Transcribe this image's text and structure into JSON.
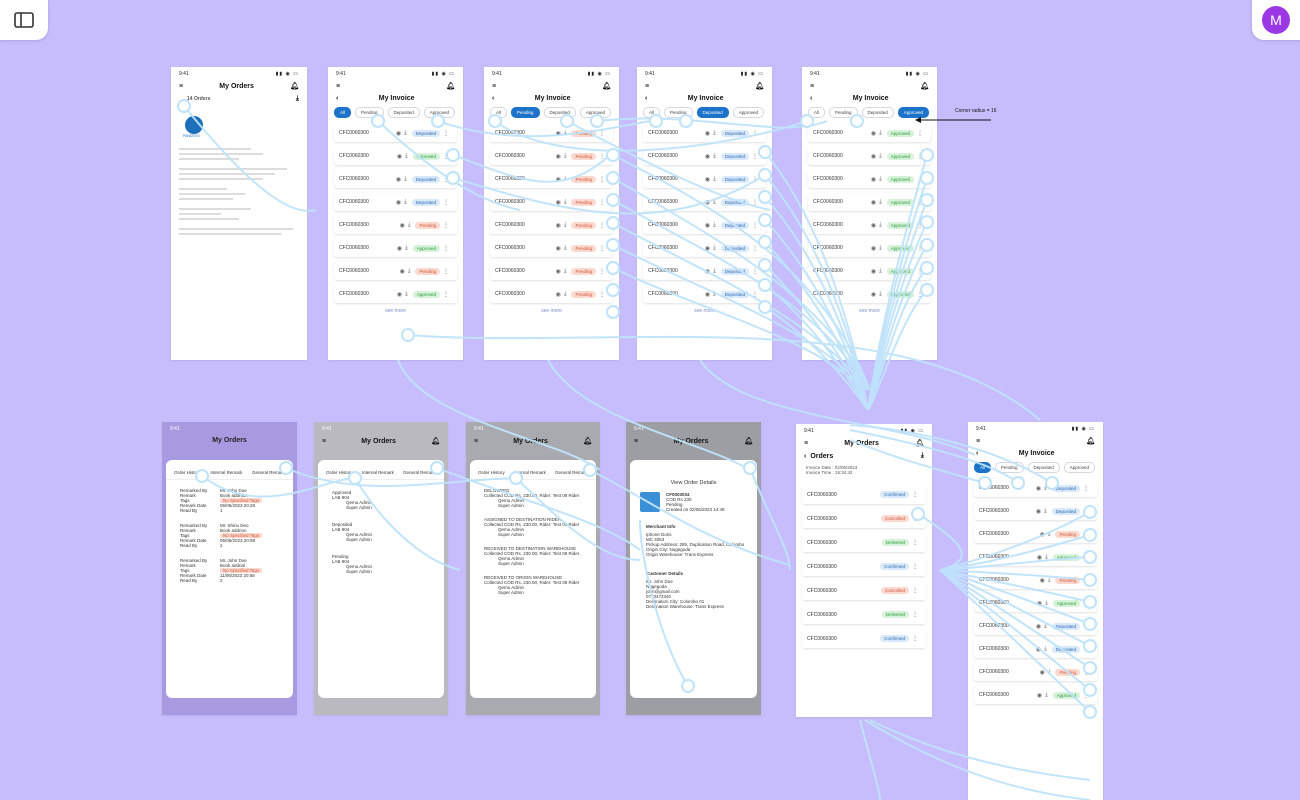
{
  "app": {
    "avatar_letter": "M"
  },
  "status_time": "9:41",
  "annotation": "Corner radius = 16",
  "order_frame": {
    "title": "My Orders",
    "subtitle": "14 Orders",
    "logo": "PANDEXO"
  },
  "invoice_title": "My Invoice",
  "filters": [
    "All",
    "Pending",
    "Deposited",
    "Approved"
  ],
  "frames": [
    {
      "active": "All",
      "rows": [
        [
          "CFC0060300",
          "Deposited"
        ],
        [
          "CFC0060300",
          "Approved"
        ],
        [
          "CFC0060300",
          "Deposited"
        ],
        [
          "CFC0060300",
          "Deposited"
        ],
        [
          "CFC0060300",
          "Pending"
        ],
        [
          "CFC0060300",
          "Approved"
        ],
        [
          "CFC0060300",
          "Pending"
        ],
        [
          "CFC0060300",
          "Approved"
        ]
      ]
    },
    {
      "active": "Pending",
      "rows": [
        [
          "CFC0060300",
          "Pending"
        ],
        [
          "CFC0060300",
          "Pending"
        ],
        [
          "CFC0060300",
          "Pending"
        ],
        [
          "CFC0060300",
          "Pending"
        ],
        [
          "CFC0060300",
          "Pending"
        ],
        [
          "CFC0060300",
          "Pending"
        ],
        [
          "CFC0060300",
          "Pending"
        ],
        [
          "CFC0060300",
          "Pending"
        ]
      ]
    },
    {
      "active": "Deposited",
      "rows": [
        [
          "CFC0060300",
          "Deposited"
        ],
        [
          "CFC0060300",
          "Deposited"
        ],
        [
          "CFC0060300",
          "Deposited"
        ],
        [
          "CFC0060300",
          "Deposited"
        ],
        [
          "CFC0060300",
          "Deposited"
        ],
        [
          "CFC0060300",
          "Deposited"
        ],
        [
          "CFC0060300",
          "Deposited"
        ],
        [
          "CFC0060300",
          "Deposited"
        ]
      ]
    },
    {
      "active": "Approved",
      "rows": [
        [
          "CFC0060300",
          "Approved"
        ],
        [
          "CFC0060300",
          "Approved"
        ],
        [
          "CFC0060300",
          "Approved"
        ],
        [
          "CFC0060300",
          "Approved"
        ],
        [
          "CFC0060300",
          "Approved"
        ],
        [
          "CFC0060300",
          "Approved"
        ],
        [
          "CFC0060300",
          "Approved"
        ],
        [
          "CFC0060300",
          "Approved"
        ]
      ]
    }
  ],
  "see_more": "see more",
  "bottom": {
    "orders_title": "My Orders",
    "tabs": [
      "Order History",
      "Internal Remark",
      "General Remark"
    ],
    "remarks": [
      {
        "by": "Mr. John Doe",
        "remark": "Book addrtion",
        "tags": "No Specified Tags",
        "date": "06/06/2023 20:28",
        "read": "1"
      },
      {
        "by": "Mr. Shiriu Deo",
        "remark": "Book addrion",
        "tags": "No Specified Tags",
        "date": "06/06/2023 20:58",
        "read": "2"
      },
      {
        "by": "Mr. John Doe",
        "remark": "Book addrial",
        "tags": "No Specified Tags",
        "date": "11/06/2023 20:58",
        "read": "2"
      }
    ],
    "remark_labels": {
      "by": "Remarked By",
      "remark": "Remark",
      "tags": "Tags",
      "date": "Remark Date",
      "read": "Read By"
    },
    "history": [
      {
        "status": "Approved",
        "sub": "LAB 904",
        "who": "Qemu Admin",
        "role": "Super Admin"
      },
      {
        "status": "Deposited",
        "sub": "LAB 904",
        "who": "Qemu Admin",
        "role": "Super Admin"
      },
      {
        "status": "Pending",
        "sub": "LAB 904",
        "who": "Qemu Admin",
        "role": "Super Admin"
      }
    ],
    "timeline": [
      {
        "status": "DELIVERED",
        "sub": "Collected COD Rs. 230.00, Rider: Test 09 Rider",
        "who": "Qemu Admin",
        "role": "Super Admin"
      },
      {
        "status": "ASSIGNED TO DESTINATION RIDER",
        "sub": "Collected COD Rs. 230.00, Rider: Test 09 Rider",
        "who": "Qemu Admin",
        "role": "Super Admin"
      },
      {
        "status": "RECEIVED TO DESTINATION WAREHOUSE",
        "sub": "Collected COD Rs. 230.00, Rider: Test 09 Rider",
        "who": "Qemu Admin",
        "role": "Super Admin"
      },
      {
        "status": "RECEIVED TO ORIGIN WAREHOUSE",
        "sub": "Collected COD Rs. 230.00, Rider: Test 09 Rider",
        "who": "Qemu Admin",
        "role": "Super Admin"
      }
    ],
    "details": {
      "head": "View Order Details",
      "id": "CF0003034",
      "l1": "COD Rs 230",
      "l2": "Pending",
      "l3": "Created on 02/06/2023 14:49",
      "merchant": "Merchant Info",
      "m1": "Iphone Doris",
      "m2": "MC 4053",
      "m3": "Pickup Address: 285, Duplication Road, Colombo",
      "m4": "Origin City: Nugegoda",
      "m5": "Origin Warehouse: Trans Express",
      "customer": "Customer Details",
      "c1": "Mr. John Doe",
      "c2": "Nugegoda",
      "c3": "john@gmail.com",
      "c4": "0773472340",
      "c5": "Destination City: Colombo 01",
      "c6": "Destination Warehouse: Trans Express"
    },
    "orders2": {
      "title": "Orders",
      "invoice_date": "Invoice Date : 02/06/2023",
      "invoice_time": "Invoice Time : 15:34:42",
      "rows": [
        [
          "CFC0060300",
          "Confirmed"
        ],
        [
          "CFC0060300",
          "Cancelled"
        ],
        [
          "CFC0060300",
          "Delivered"
        ],
        [
          "CFC0060300",
          "Confirmed"
        ],
        [
          "CFC0060300",
          "Cancelled"
        ],
        [
          "CFC0060300",
          "Delivered"
        ],
        [
          "CFC0060300",
          "Confirmed"
        ]
      ]
    },
    "invoice2_rows": [
      [
        "CFC0060300",
        "Deposited"
      ],
      [
        "CFC0060300",
        "Deposited"
      ],
      [
        "CFC0060300",
        "Pending"
      ],
      [
        "CFC0060300",
        "Approved"
      ],
      [
        "CFC0060300",
        "Pending"
      ],
      [
        "CFC0060300",
        "Approved"
      ],
      [
        "CFC0060300",
        "Deposited"
      ],
      [
        "CFC0060300",
        "Deposited"
      ],
      [
        "CFC0060300",
        "Pending"
      ],
      [
        "CFC0060300",
        "Approved"
      ]
    ]
  }
}
